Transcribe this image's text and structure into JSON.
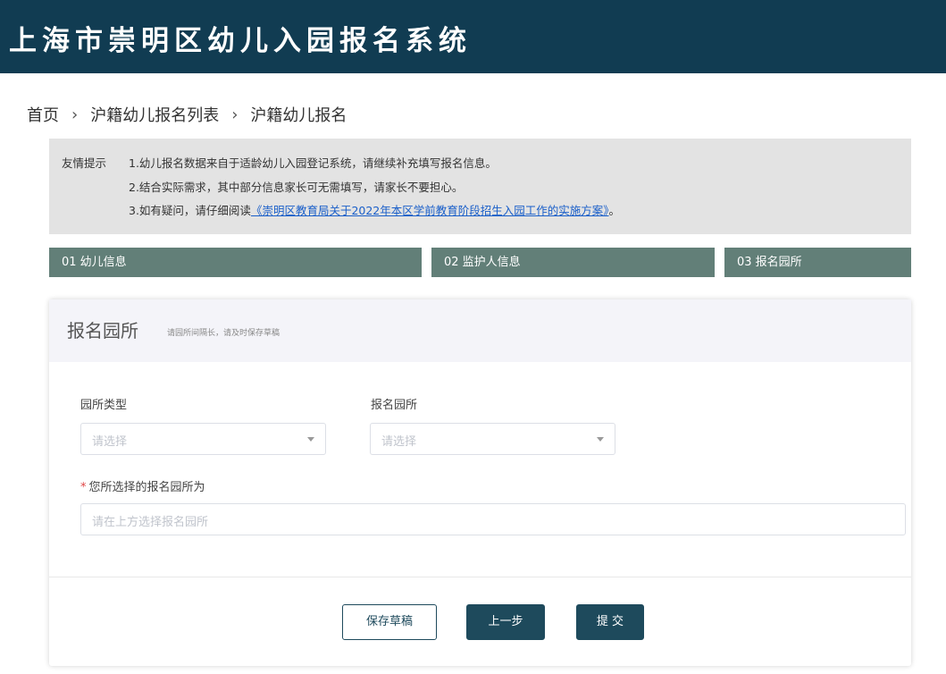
{
  "header": {
    "title": "上海市崇明区幼儿入园报名系统"
  },
  "breadcrumb": {
    "items": [
      "首页",
      "沪籍幼儿报名列表",
      "沪籍幼儿报名"
    ],
    "separator": "›"
  },
  "notice": {
    "label": "友情提示",
    "line1": "1.幼儿报名数据来自于适龄幼儿入园登记系统，请继续补充填写报名信息。",
    "line2": "2.结合实际需求，其中部分信息家长可无需填写，请家长不要担心。",
    "line3_prefix": "3.如有疑问，请仔细阅读",
    "line3_link": "《崇明区教育局关于2022年本区学前教育阶段招生入园工作的实施方案》",
    "line3_suffix": "。"
  },
  "steps": [
    "01 幼儿信息",
    "02 监护人信息",
    "03 报名园所"
  ],
  "panel": {
    "title": "报名园所",
    "hint": "请园所间隔长，请及时保存草稿",
    "type_label": "园所类型",
    "type_placeholder": "请选择",
    "school_label": "报名园所",
    "school_placeholder": "请选择",
    "selected_label": "您所选择的报名园所为",
    "selected_placeholder": "请在上方选择报名园所"
  },
  "buttons": {
    "save": "保存草稿",
    "prev": "上一步",
    "submit": "提 交"
  },
  "colors": {
    "header_bg": "#113c52",
    "step_bg": "#627f78",
    "primary": "#1e4a5c",
    "link": "#1a5fc9"
  }
}
